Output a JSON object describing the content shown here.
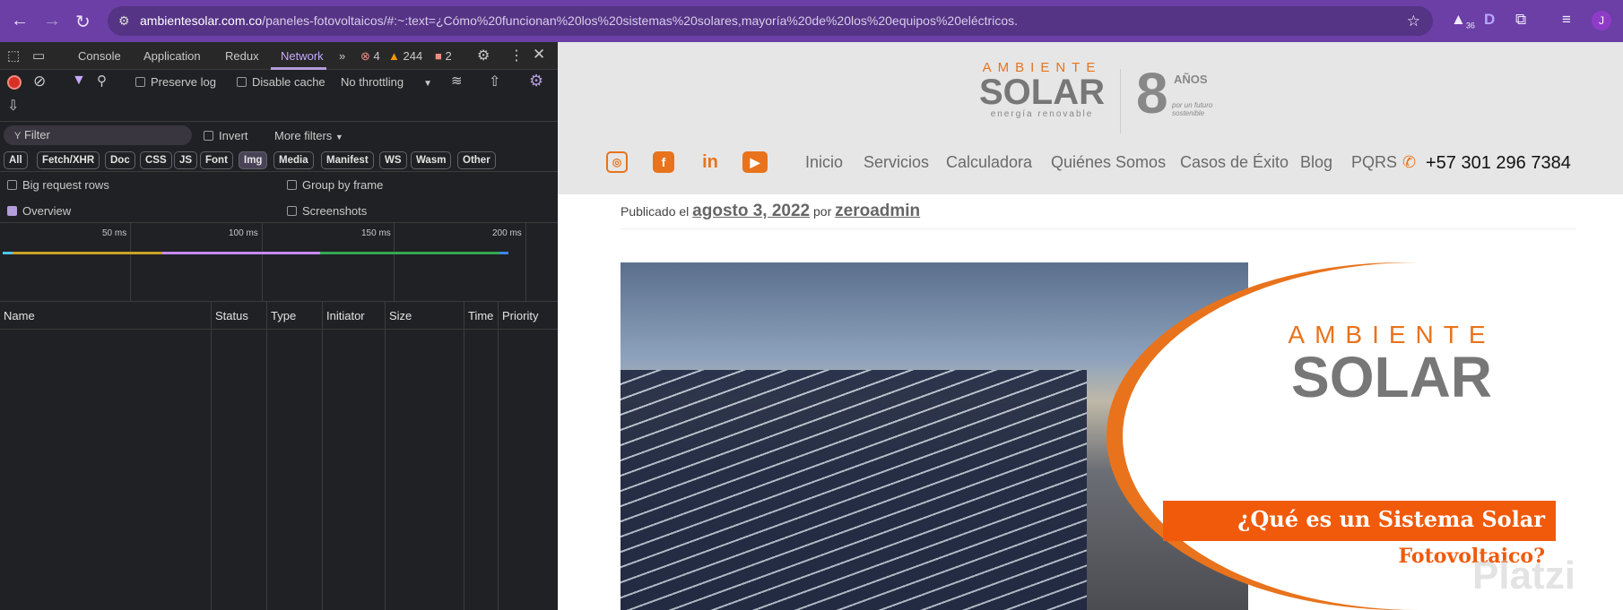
{
  "browser": {
    "url_domain": "ambientesolar.com.co",
    "url_rest": "/paneles-fotovoltaicos/#:~:text=¿Cómo%20funcionan%20los%20sistemas%20solares,mayoría%20de%20los%20equipos%20eléctricos.",
    "ext_badge": "36",
    "profile": "J"
  },
  "devtools": {
    "tabs": [
      "Console",
      "Application",
      "Redux",
      "Network"
    ],
    "errors": "4",
    "warnings": "244",
    "issues": "2",
    "preserve_log": "Preserve log",
    "disable_cache": "Disable cache",
    "throttling": "No throttling",
    "filter_placeholder": "Filter",
    "invert": "Invert",
    "more_filters": "More filters",
    "types": [
      "All",
      "Fetch/XHR",
      "Doc",
      "CSS",
      "JS",
      "Font",
      "Img",
      "Media",
      "Manifest",
      "WS",
      "Wasm",
      "Other"
    ],
    "big_rows": "Big request rows",
    "group_frame": "Group by frame",
    "overview": "Overview",
    "screenshots": "Screenshots",
    "ticks": [
      "50 ms",
      "100 ms",
      "150 ms",
      "200 ms"
    ],
    "columns": [
      "Name",
      "Status",
      "Type",
      "Initiator",
      "Size",
      "Time",
      "Priority"
    ]
  },
  "site": {
    "logo_top": "AMBIENTE",
    "logo_main": "SOLAR",
    "logo_sub": "energía renovable",
    "anniv_num": "8",
    "anniv_word": "AÑOS",
    "anniv_tag": "por un futuro sostenible",
    "nav": [
      "Inicio",
      "Servicios",
      "Calculadora",
      "Quiénes Somos",
      "Casos de Éxito",
      "Blog",
      "PQRS"
    ],
    "phone": "+57 301 296 7384",
    "published_prefix": "Publicado el",
    "date": "agosto 3, 2022",
    "by": "por",
    "author": "zeroadmin",
    "banner_line1": "¿Qué es un Sistema Solar",
    "banner_line2": "Fotovoltaico?",
    "watermark": "Platzi"
  }
}
